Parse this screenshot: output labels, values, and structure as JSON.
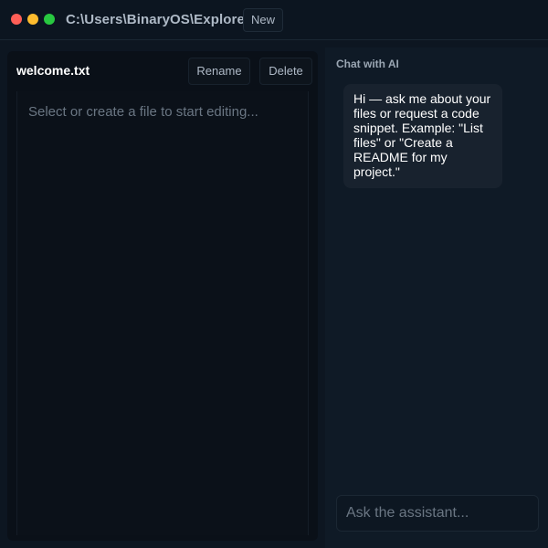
{
  "titlebar": {
    "path": "C:\\Users\\BinaryOS\\Explorer",
    "new_label": "New",
    "window_controls": [
      "close",
      "minimize",
      "maximize"
    ]
  },
  "editor": {
    "file_name": "welcome.txt",
    "rename_label": "Rename",
    "delete_label": "Delete",
    "placeholder": "Select or create a file to start editing..."
  },
  "chat": {
    "title": "Chat with AI",
    "messages": [
      {
        "role": "assistant",
        "text": "Hi — ask me about your files or request a code snippet. Example: \"List files\" or \"Create a README for my project.\""
      }
    ],
    "input_placeholder": "Ask the assistant..."
  },
  "colors": {
    "background": "#0d1621",
    "close": "#ff5f57",
    "minimize": "#febc2e",
    "maximize": "#28c840"
  }
}
